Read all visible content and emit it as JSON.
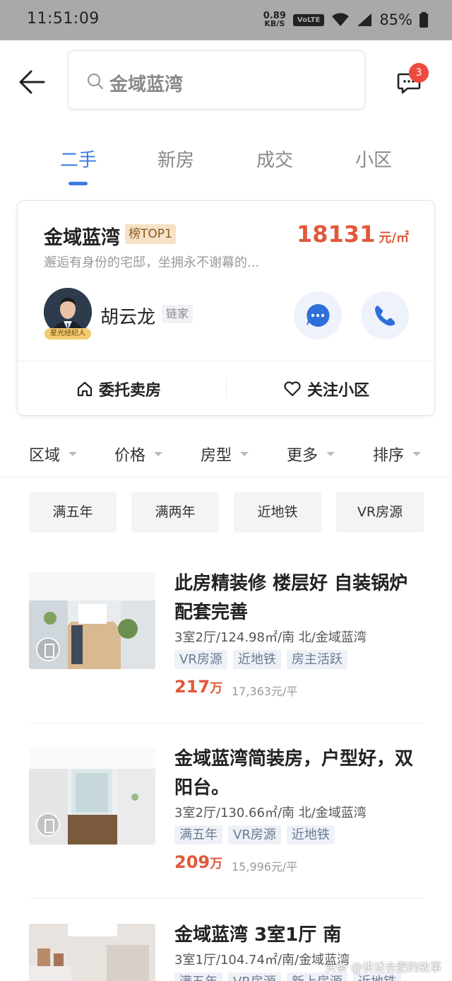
{
  "status_bar": {
    "time": "11:51:09",
    "speed_value": "0.89",
    "speed_unit": "KB/S",
    "network": "VoLTE",
    "battery": "85%"
  },
  "header": {
    "search_text": "金域蓝湾",
    "message_count": "3"
  },
  "tabs": [
    {
      "label": "二手",
      "active": true
    },
    {
      "label": "新房",
      "active": false
    },
    {
      "label": "成交",
      "active": false
    },
    {
      "label": "小区",
      "active": false
    }
  ],
  "community_card": {
    "name": "金域蓝湾",
    "rank": "榜TOP1",
    "price": "18131",
    "price_unit": "元/㎡",
    "description": "邂逅有身份的宅邸，坐拥永不谢幕的...",
    "agent": {
      "name": "胡云龙",
      "company": "链家",
      "badge": "星光经纪人"
    },
    "actions": {
      "entrust": "委托卖房",
      "follow": "关注小区"
    }
  },
  "filters": [
    "区域",
    "价格",
    "房型",
    "更多",
    "排序"
  ],
  "chips": [
    "满五年",
    "满两年",
    "近地铁",
    "VR房源"
  ],
  "listings": [
    {
      "title": "此房精装修 楼层好 自装锅炉配套完善",
      "meta": "3室2厅/124.98㎡/南 北/金域蓝湾",
      "tags": [
        "VR房源",
        "近地铁",
        "房主活跃"
      ],
      "price": "217",
      "price_unit": "万",
      "unit_price": "17,363元/平"
    },
    {
      "title": "金域蓝湾简装房，户型好，双阳台。",
      "meta": "3室2厅/130.66㎡/南 北/金域蓝湾",
      "tags": [
        "满五年",
        "VR房源",
        "近地铁"
      ],
      "price": "209",
      "price_unit": "万",
      "unit_price": "15,996元/平"
    },
    {
      "title": "金域蓝湾 3室1厅 南",
      "meta": "3室1厅/104.74㎡/南/金域蓝湾",
      "tags": [
        "满五年",
        "VR房源",
        "新上房源",
        "近地铁"
      ]
    }
  ],
  "watermark": "头条 @讲述合肥的故事",
  "colors": {
    "accent_blue": "#3b7be0",
    "price_red": "#e0593b",
    "badge_red": "#ee4a3f",
    "status_bar_gray": "#a9a9a9"
  }
}
